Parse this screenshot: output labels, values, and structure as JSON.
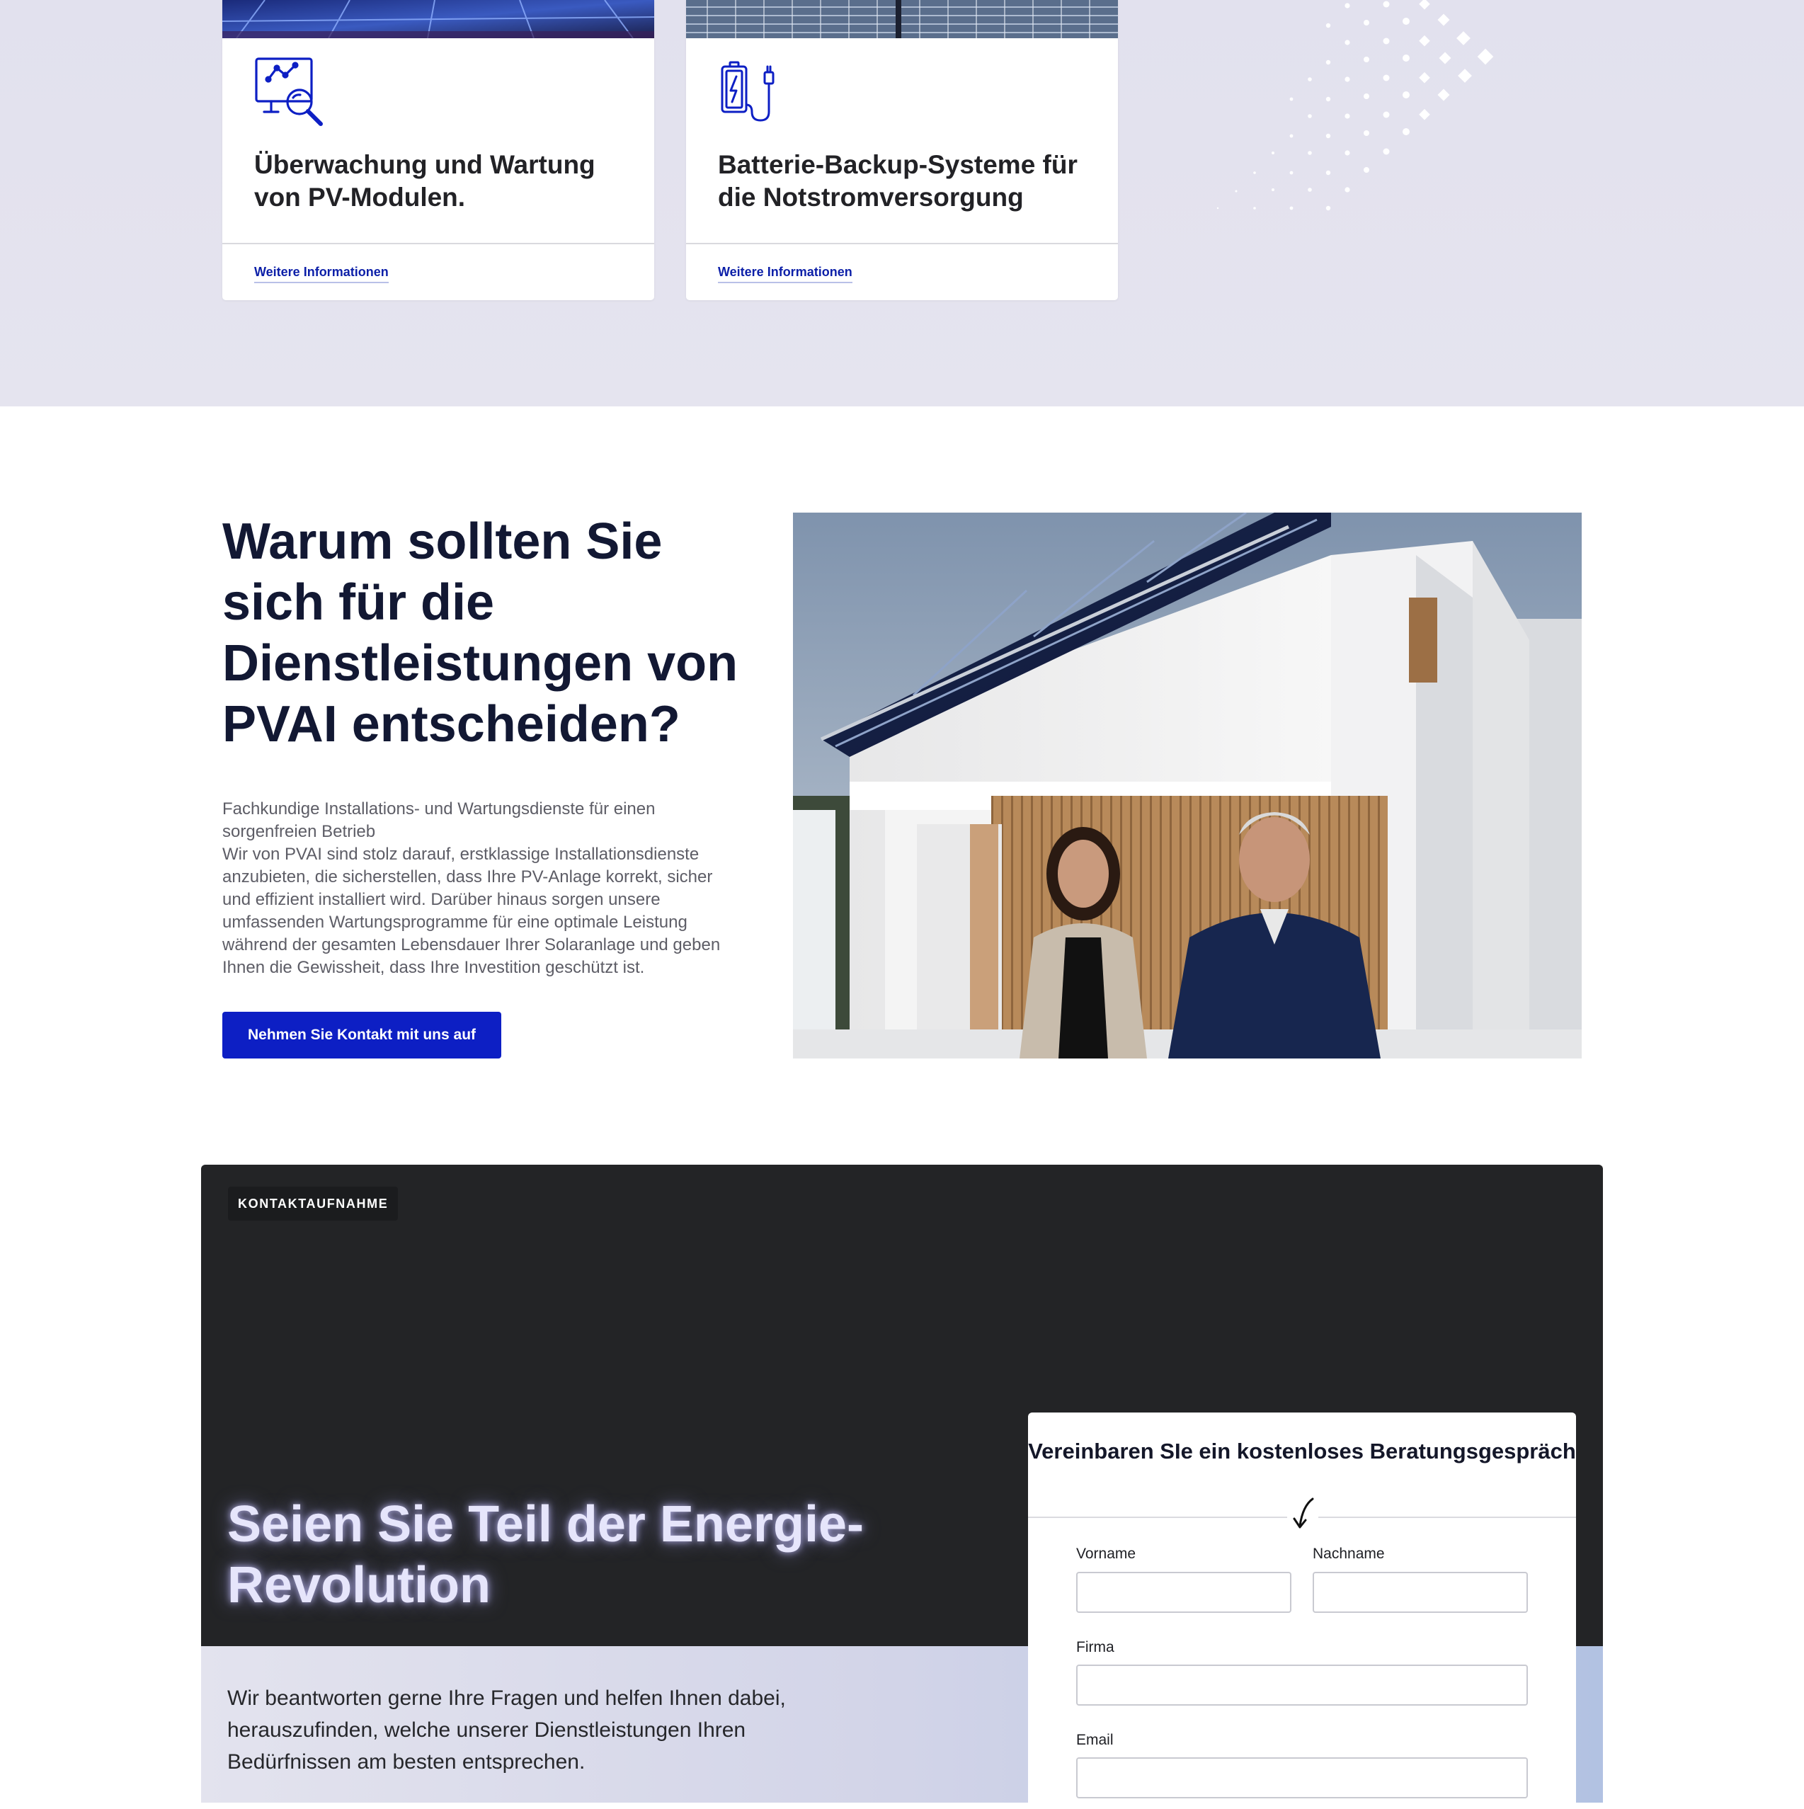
{
  "services": {
    "cards": [
      {
        "title": "Überwachung und Wartung von PV-Modulen.",
        "icon": "monitoring-search-icon",
        "link": "Weitere Informationen"
      },
      {
        "title": "Batterie-Backup-Systeme für die Notstromversorgung",
        "icon": "battery-charging-icon",
        "link": "Weitere Informationen"
      }
    ]
  },
  "why": {
    "heading": "Warum sollten Sie sich für die Dienstleistungen von PVAI entscheiden?",
    "paragraph_1": "Fachkundige Installations- und Wartungsdienste für einen sorgenfreien Betrieb",
    "paragraph_2": "Wir von PVAI sind stolz darauf, erstklassige Installationsdienste anzubieten, die sicherstellen, dass Ihre PV-Anlage korrekt, sicher und effizient installiert wird. Darüber hinaus sorgen unsere umfassenden Wartungsprogramme für eine optimale Leistung während der gesamten Lebensdauer Ihrer Solaranlage und geben Ihnen die Gewissheit, dass Ihre Investition geschützt ist.",
    "cta_label": "Nehmen Sie Kontakt mit uns auf"
  },
  "contact": {
    "badge": "KONTAKTAUFNAHME",
    "heading": "Seien Sie Teil der Energie-Revolution",
    "text": "Wir beantworten gerne Ihre Fragen und helfen Ihnen dabei, herauszufinden, welche unserer Dienstleistungen Ihren Bedürfnissen am besten entsprechen.",
    "form": {
      "title": "Vereinbaren SIe ein kostenloses Beratungsgespräch",
      "first_name_label": "Vorname",
      "last_name_label": "Nachname",
      "company_label": "Firma",
      "email_label": "Email"
    }
  },
  "colors": {
    "primary": "#0d1fc4",
    "link": "#0c1fa8",
    "heading": "#121833",
    "dark_panel": "#232426",
    "band": "#e2e1ee"
  }
}
